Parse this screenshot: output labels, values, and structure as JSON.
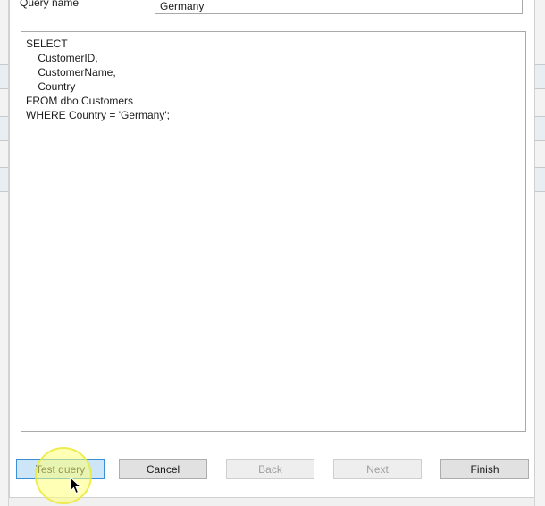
{
  "dialog": {
    "query_name_label": "Query name",
    "query_name_value": "Germany",
    "sql_lines": [
      "SELECT",
      "    CustomerID,",
      "    CustomerName,",
      "    Country",
      "FROM dbo.Customers",
      "WHERE Country = 'Germany';"
    ]
  },
  "buttons": {
    "test_query": "Test query",
    "cancel": "Cancel",
    "back": "Back",
    "next": "Next",
    "finish": "Finish"
  },
  "colors": {
    "focus_highlight": "#cde6f7",
    "click_highlight": "#ffff78"
  },
  "icons": {
    "cursor": "mouse-pointer-icon"
  }
}
